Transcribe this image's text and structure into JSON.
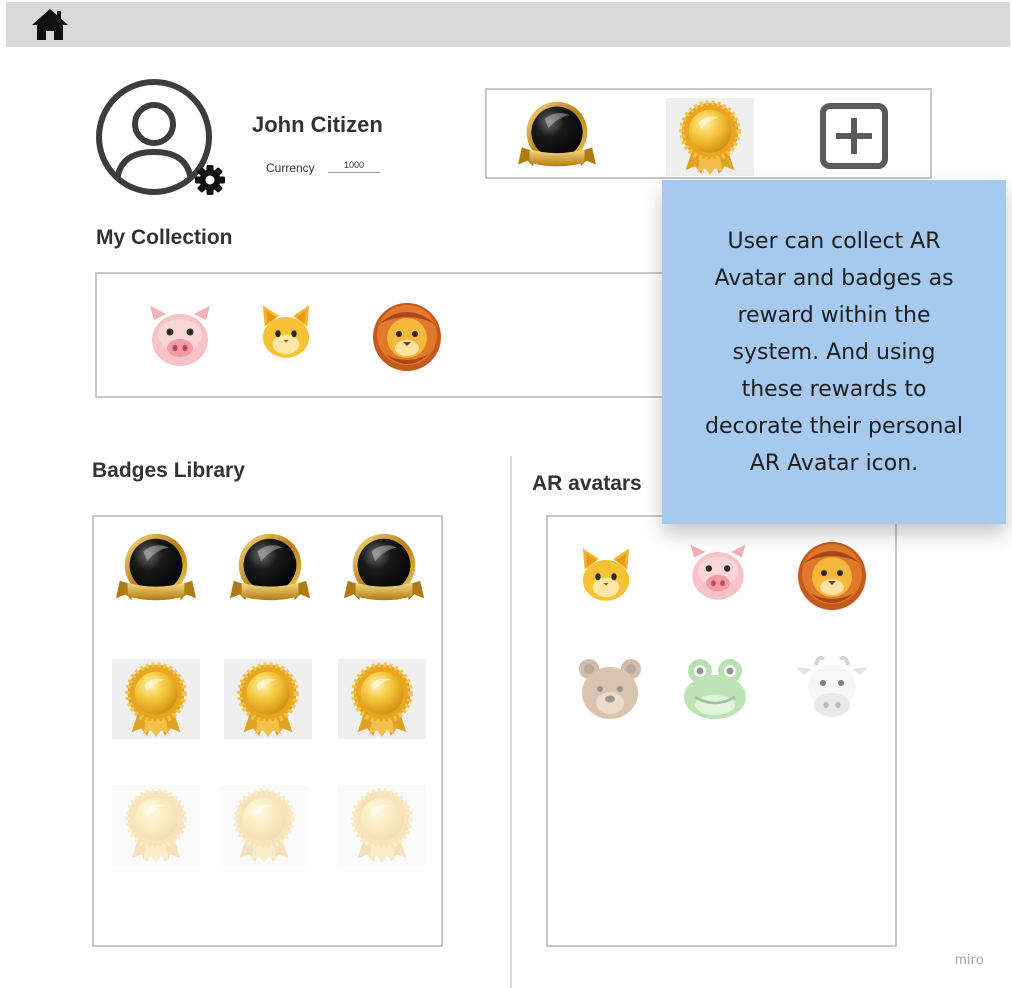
{
  "profile": {
    "name": "John Citizen",
    "currency_label": "Currency",
    "currency_value": "1000"
  },
  "equipped_badges": [
    "black-gold-badge-icon",
    "gold-rosette-badge-icon",
    "add-badge-icon"
  ],
  "collection": {
    "title": "My Collection",
    "items": [
      "pig-avatar-icon",
      "cat-avatar-icon",
      "lion-avatar-icon"
    ]
  },
  "badges_library": {
    "title": "Badges Library",
    "rows": [
      {
        "badge": "black-gold-badge-icon",
        "state": "unlocked",
        "count": 3
      },
      {
        "badge": "gold-rosette-badge-icon",
        "state": "unlocked",
        "count": 3
      },
      {
        "badge": "gold-rosette-badge-icon",
        "state": "locked",
        "count": 3
      }
    ]
  },
  "ar_avatars": {
    "title": "AR avatars",
    "items": [
      {
        "icon": "cat-avatar-icon",
        "state": "owned"
      },
      {
        "icon": "pig-avatar-icon",
        "state": "owned"
      },
      {
        "icon": "lion-avatar-icon",
        "state": "owned"
      },
      {
        "icon": "bear-avatar-icon",
        "state": "locked"
      },
      {
        "icon": "frog-avatar-icon",
        "state": "locked"
      },
      {
        "icon": "cow-avatar-icon",
        "state": "locked"
      }
    ]
  },
  "sticky_note": {
    "lines": [
      "User can collect AR",
      "Avatar and badges as",
      "reward within the",
      "system. And using",
      "these rewards to",
      "decorate their personal",
      "AR Avatar icon."
    ]
  },
  "watermark": "miro",
  "colors": {
    "topbar": "#d9d9d9",
    "sticky_note": "#a6c9f0",
    "gold": "#f3b11f",
    "border": "#c7c7c7"
  }
}
